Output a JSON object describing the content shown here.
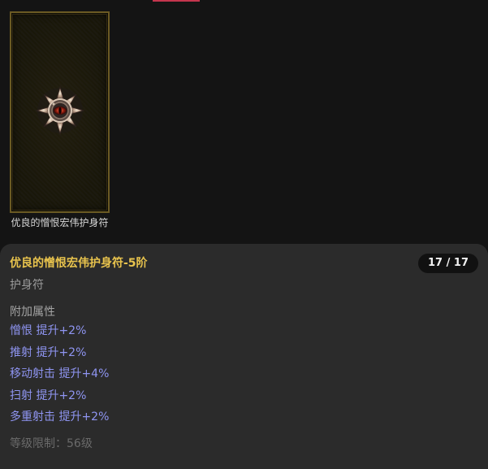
{
  "item_grid": {
    "items": [
      {
        "name": "优良的憎恨宏伟护身符",
        "icon": "amulet-icon",
        "border_color": "#6b5a23"
      }
    ]
  },
  "tooltip": {
    "title": "优良的憎恨宏伟护身符-5阶",
    "stack_count": "17 / 17",
    "item_type": "护身符",
    "affix_section_label": "附加属性",
    "affixes": [
      "憎恨 提升+2%",
      "推射 提升+2%",
      "移动射击 提升+4%",
      "扫射 提升+2%",
      "多重射击 提升+2%"
    ],
    "level_requirement": "等级限制：56级",
    "colors": {
      "title": "#e8c34d",
      "affix": "#8f95f2",
      "type": "#9b9b9b",
      "level": "#6a6a6a",
      "panel_bg": "#2b2b2b",
      "page_bg": "#141414",
      "accent": "#c4354d"
    }
  }
}
